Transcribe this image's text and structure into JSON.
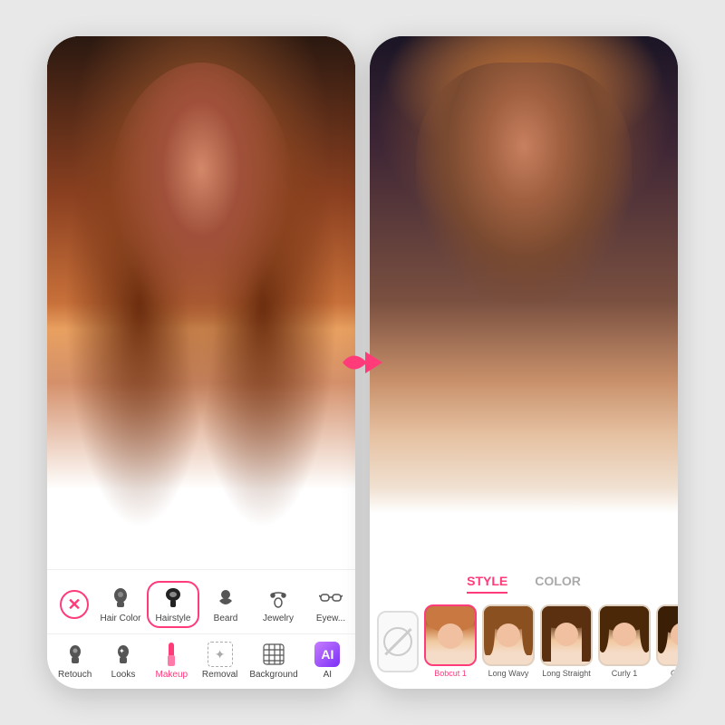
{
  "left_phone": {
    "toolbar_row1": [
      {
        "id": "cancel",
        "label": "",
        "type": "cancel"
      },
      {
        "id": "hair-color",
        "label": "Hair Color",
        "icon": "💇",
        "type": "normal"
      },
      {
        "id": "hairstyle",
        "label": "Hairstyle",
        "icon": "👤",
        "type": "active"
      },
      {
        "id": "beard",
        "label": "Beard",
        "icon": "🧔",
        "type": "normal"
      },
      {
        "id": "jewelry",
        "label": "Jewelry",
        "icon": "💎",
        "type": "normal"
      },
      {
        "id": "eyewear",
        "label": "Eyew...",
        "icon": "👓",
        "type": "normal"
      }
    ],
    "toolbar_row2": [
      {
        "id": "retouch",
        "label": "Retouch",
        "icon": "👤"
      },
      {
        "id": "looks",
        "label": "Looks",
        "icon": "✨"
      },
      {
        "id": "makeup",
        "label": "Makeup",
        "icon": "💄",
        "active": true
      },
      {
        "id": "removal",
        "label": "Removal",
        "icon": "✂️"
      },
      {
        "id": "background",
        "label": "Background",
        "icon": "▦"
      },
      {
        "id": "ai",
        "label": "AI",
        "icon": "AI"
      }
    ]
  },
  "arrow": {
    "color": "#ff3b7a"
  },
  "right_phone": {
    "tabs": [
      {
        "id": "style",
        "label": "STYLE",
        "active": true
      },
      {
        "id": "color",
        "label": "COLOR",
        "active": false
      }
    ],
    "hairstyles": [
      {
        "id": "none",
        "label": "",
        "type": "none"
      },
      {
        "id": "bobcut1",
        "label": "Bobcut 1",
        "selected": true,
        "color": "#c87840"
      },
      {
        "id": "longwavy",
        "label": "Long Wavy",
        "selected": false,
        "color": "#8b5020"
      },
      {
        "id": "longstraight",
        "label": "Long Straight",
        "selected": false,
        "color": "#5a3010"
      },
      {
        "id": "curly1",
        "label": "Curly 1",
        "selected": false,
        "color": "#4a2808"
      },
      {
        "id": "curly2",
        "label": "Curly !",
        "selected": false,
        "color": "#3a1e06"
      }
    ]
  }
}
